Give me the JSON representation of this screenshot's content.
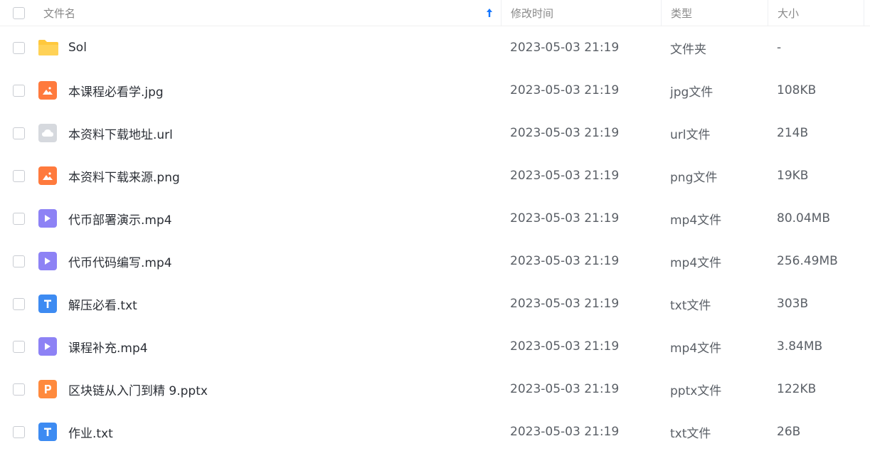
{
  "header": {
    "name": "文件名",
    "modified": "修改时间",
    "type": "类型",
    "size": "大小",
    "sort": "sort-ascending-icon"
  },
  "files": [
    {
      "name": "Sol",
      "modified": "2023-05-03 21:19",
      "type": "文件夹",
      "size": "-",
      "icon": "folder-icon"
    },
    {
      "name": "本课程必看学.jpg",
      "modified": "2023-05-03 21:19",
      "type": "jpg文件",
      "size": "108KB",
      "icon": "image-file-icon"
    },
    {
      "name": "本资料下载地址.url",
      "modified": "2023-05-03 21:19",
      "type": "url文件",
      "size": "214B",
      "icon": "cloud-file-icon"
    },
    {
      "name": "本资料下载来源.png",
      "modified": "2023-05-03 21:19",
      "type": "png文件",
      "size": "19KB",
      "icon": "image-file-icon"
    },
    {
      "name": "代币部署演示.mp4",
      "modified": "2023-05-03 21:19",
      "type": "mp4文件",
      "size": "80.04MB",
      "icon": "video-file-icon"
    },
    {
      "name": "代币代码编写.mp4",
      "modified": "2023-05-03 21:19",
      "type": "mp4文件",
      "size": "256.49MB",
      "icon": "video-file-icon"
    },
    {
      "name": "解压必看.txt",
      "modified": "2023-05-03 21:19",
      "type": "txt文件",
      "size": "303B",
      "icon": "text-file-icon"
    },
    {
      "name": "课程补充.mp4",
      "modified": "2023-05-03 21:19",
      "type": "mp4文件",
      "size": "3.84MB",
      "icon": "video-file-icon"
    },
    {
      "name": "区块链从入门到精 9.pptx",
      "modified": "2023-05-03 21:19",
      "type": "pptx文件",
      "size": "122KB",
      "icon": "ppt-file-icon"
    },
    {
      "name": "作业.txt",
      "modified": "2023-05-03 21:19",
      "type": "txt文件",
      "size": "26B",
      "icon": "text-file-icon"
    }
  ],
  "colors": {
    "folder": "#ffc83d",
    "image": "#ff7a3d",
    "cloud": "#d6d9de",
    "video": "#8d82f5",
    "text": "#3d8bf2",
    "ppt": "#ff8a3d",
    "sort_arrow": "#1677ff"
  }
}
